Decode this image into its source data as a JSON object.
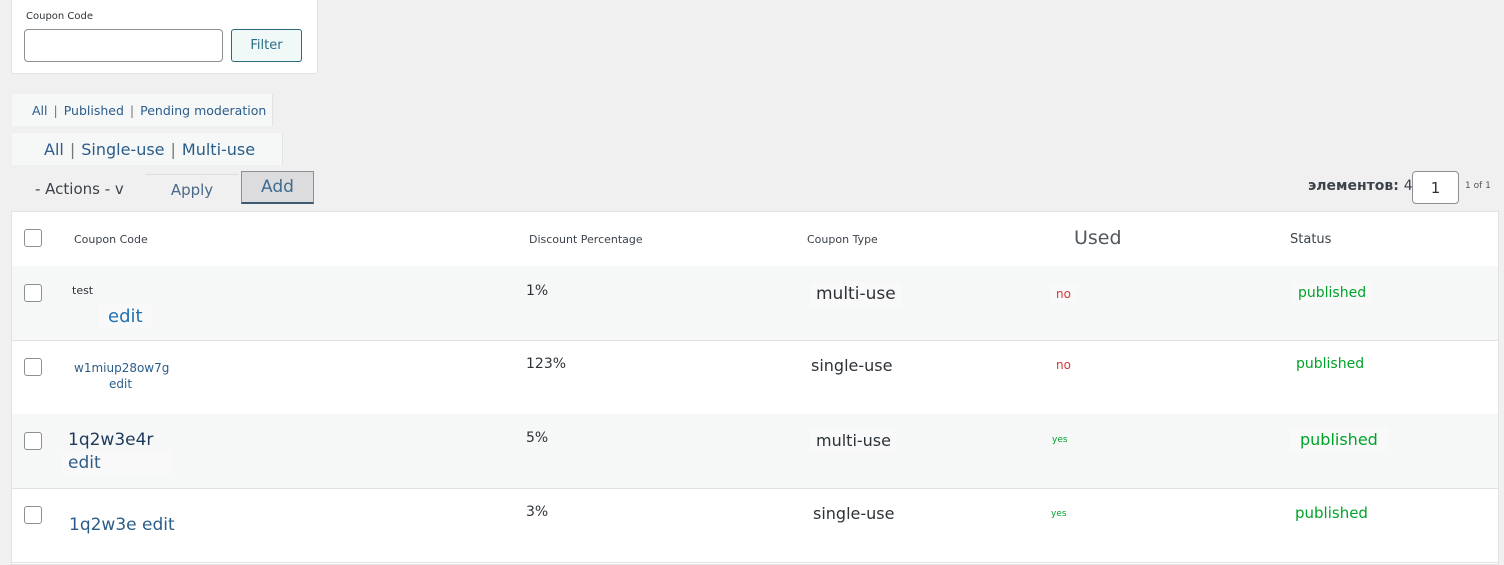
{
  "filter": {
    "label": "Coupon Code",
    "input_value": "",
    "button": "Filter"
  },
  "status_views": {
    "items": [
      "All",
      "Published",
      "Pending moderation"
    ],
    "separator": "|"
  },
  "type_views": {
    "items": [
      "All",
      "Single-use",
      "Multi-use"
    ],
    "separator": "|"
  },
  "bulk": {
    "actions_label": "- Actions - v",
    "apply": "Apply",
    "add": "Add"
  },
  "pagination": {
    "count_label": "элементов:",
    "count_value": "4 -",
    "current_page": "1",
    "of_text": "1 of 1"
  },
  "table": {
    "headers": {
      "code": "Coupon Code",
      "discount": "Discount Percentage",
      "type": "Coupon Type",
      "used": "Used",
      "status": "Status"
    },
    "rows": [
      {
        "code": "test",
        "edit": "edit",
        "discount": "1%",
        "type": "multi-use",
        "used": "no",
        "status": "published"
      },
      {
        "code": "w1miup28ow7g",
        "edit": "edit",
        "discount": "123%",
        "type": "single-use",
        "used": "no",
        "status": "published"
      },
      {
        "code": "1q2w3e4r",
        "edit": "edit",
        "discount": "5%",
        "type": "multi-use",
        "used": "yes",
        "status": "published"
      },
      {
        "code": "1q2w3e",
        "edit": "edit",
        "discount": "3%",
        "type": "single-use",
        "used": "yes",
        "status": "published"
      }
    ]
  }
}
